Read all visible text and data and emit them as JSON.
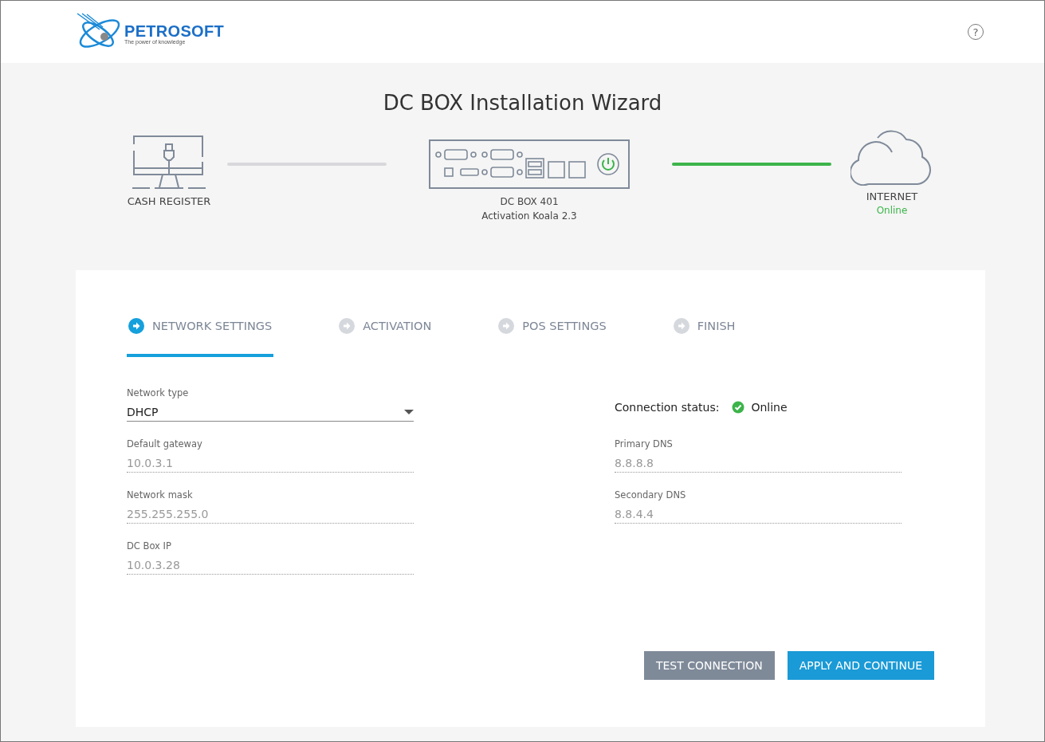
{
  "header": {
    "logo": {
      "name": "PETROSOFT",
      "tagline": "The power of knowledge"
    },
    "help": "?"
  },
  "title": "DC BOX Installation Wizard",
  "diagram": {
    "cash_register": {
      "label": "CASH REGISTER"
    },
    "links": [
      {
        "connected": false
      },
      {
        "connected": true
      }
    ],
    "dc_box": {
      "label": "DC BOX 401",
      "sublabel": "Activation Koala 2.3",
      "powered": true
    },
    "internet": {
      "label": "INTERNET",
      "status": "Online",
      "online": true
    }
  },
  "steps": [
    {
      "label": "NETWORK SETTINGS",
      "selected": true
    },
    {
      "label": "ACTIVATION",
      "selected": false
    },
    {
      "label": "POS SETTINGS",
      "selected": false
    },
    {
      "label": "FINISH",
      "selected": false
    }
  ],
  "left_fields": [
    {
      "kind": "dropdown",
      "label": "Network type",
      "value": "DHCP",
      "disabled": false
    },
    {
      "kind": "text",
      "label": "Default gateway",
      "value": "10.0.3.1",
      "disabled": true
    },
    {
      "kind": "text",
      "label": "Network mask",
      "value": "255.255.255.0",
      "disabled": true
    },
    {
      "kind": "text",
      "label": "DC Box IP",
      "value": "10.0.3.28",
      "disabled": true
    }
  ],
  "connection_status": {
    "label": "Connection status:",
    "value": "Online",
    "online": true
  },
  "right_fields": [
    {
      "label": "Primary DNS",
      "value": "8.8.8.8",
      "disabled": true
    },
    {
      "label": "Secondary DNS",
      "value": "8.8.4.4",
      "disabled": true
    }
  ],
  "buttons": [
    {
      "label": "TEST CONNECTION",
      "kind": "secondary"
    },
    {
      "label": "APPLY AND CONTINUE",
      "kind": "primary"
    }
  ]
}
